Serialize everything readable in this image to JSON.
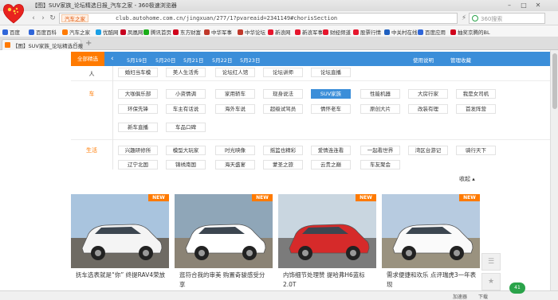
{
  "window": {
    "title": "【图】SUV家族_论坛精选日报_汽车之家 - 360极速浏览器"
  },
  "address_bar": {
    "site_label": "汽车之家",
    "url": "club.autohome.com.cn/jingxuan/277/1?pvareaid=2341149#chorisSection",
    "search_placeholder": "360搜索"
  },
  "bookmarks": [
    {
      "label": "百度",
      "color": "#2f66d9"
    },
    {
      "label": "百度百科",
      "color": "#2f66d9"
    },
    {
      "label": "汽车之家",
      "color": "#ff7a00"
    },
    {
      "label": "优酷网",
      "color": "#1aa0e6"
    },
    {
      "label": "凤凰网",
      "color": "#c7001f"
    },
    {
      "label": "腾讯首页",
      "color": "#1aad19"
    },
    {
      "label": "东方财富",
      "color": "#d0021b"
    },
    {
      "label": "中华军事",
      "color": "#c0392b"
    },
    {
      "label": "中华论坛",
      "color": "#c0392b"
    },
    {
      "label": "新浪网",
      "color": "#e6162d"
    },
    {
      "label": "新浪军事",
      "color": "#e6162d"
    },
    {
      "label": "财经频道",
      "color": "#e6162d"
    },
    {
      "label": "股票行情",
      "color": "#e6162d"
    },
    {
      "label": "中关村在线",
      "color": "#1f5fbf"
    },
    {
      "label": "百度应用",
      "color": "#2f66d9"
    },
    {
      "label": "抽奖京腾的BL",
      "color": "#d0021b"
    }
  ],
  "tab": {
    "label": "【图】SUV家族_论坛精选日报"
  },
  "date_nav": {
    "selected": "全部精选",
    "dates": [
      "5月19日",
      "5月20日",
      "5月21日",
      "5月22日",
      "5月23日"
    ],
    "right_links": [
      "使用说明",
      "管理收藏"
    ]
  },
  "categories": [
    {
      "label": "人",
      "chips": [
        "婚妇当车模",
        "美人生活秀",
        "论坛红人馆",
        "论坛讲师",
        "论坛直播"
      ]
    },
    {
      "label": "车",
      "chips": [
        "大咖俱乐部",
        "小资情调",
        "家用轿车",
        "现身说法",
        "SUV家族",
        "性能机器",
        "大房行家",
        "我是女司机",
        "环保先锋",
        "车主有话说",
        "海外车说",
        "超级试驾员",
        "情怀老车",
        "原创大片",
        "改装有理",
        "首发阵营",
        "新车直播",
        "车品口碑"
      ],
      "selected": "SUV家族"
    },
    {
      "label": "生活",
      "chips": [
        "兴趣研修所",
        "模型大玩家",
        "时光映像",
        "摇篮也精彩",
        "爱情连连看",
        "一起看世界",
        "湾区台游记",
        "骑行天下",
        "辽宁北国",
        "锦绣南国",
        "海天盛宴",
        "蒙圣之旅",
        "云贵之巅",
        "车友聚会"
      ]
    }
  ],
  "fold_label": "收起",
  "cards": [
    {
      "badge": "NEW",
      "caption": "抚车选表就是“你” 终提RAV4荣放",
      "car_color": "#f4f4f4"
    },
    {
      "badge": "NEW",
      "caption": "逛符合我的审美 购置奇骏感受分享",
      "car_color": "#ffffff"
    },
    {
      "badge": "NEW",
      "caption": "内饰细节处理赞 提哈弗H6蓝标2.0T",
      "car_color": "#d62a2a"
    },
    {
      "badge": "NEW",
      "caption": "需求便捷和欢乐 点评瑞虎3一年表现",
      "car_color": "#fafafa"
    }
  ],
  "side_tools": [
    "☰",
    "★"
  ],
  "status": {
    "left": "加速器",
    "download": "下载",
    "widget": "41"
  }
}
